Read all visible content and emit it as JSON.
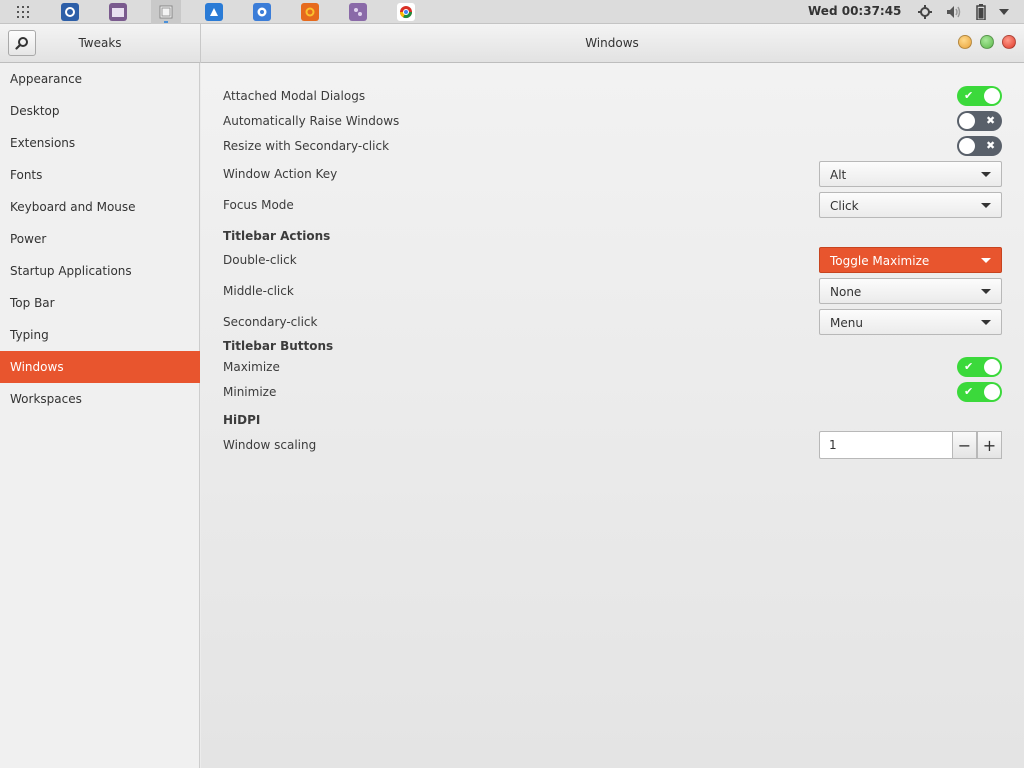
{
  "taskbar": {
    "launchers": [
      {
        "icon": "app-grid-icon"
      },
      {
        "icon": "software-center-icon",
        "color": "#2d5fa8"
      },
      {
        "icon": "files-icon",
        "color": "#7a5a8e"
      },
      {
        "icon": "tweaks-icon",
        "color": "#8e8e8e"
      },
      {
        "icon": "store-icon",
        "color": "#2a7bd6"
      },
      {
        "icon": "settings-icon",
        "color": "#3b7dd8"
      },
      {
        "icon": "firefox-icon",
        "color": "#e66a1d"
      },
      {
        "icon": "editor-icon",
        "color": "#8a6aa8"
      },
      {
        "icon": "chrome-icon",
        "color": "#d93025"
      }
    ],
    "clock": "Wed 00:37:45",
    "tray": [
      "location-icon",
      "volume-icon",
      "battery-icon",
      "menu-arrow-icon"
    ]
  },
  "header": {
    "app_title": "Tweaks",
    "page_title": "Windows"
  },
  "sidebar": {
    "items": [
      {
        "label": "Appearance"
      },
      {
        "label": "Desktop"
      },
      {
        "label": "Extensions"
      },
      {
        "label": "Fonts"
      },
      {
        "label": "Keyboard and Mouse"
      },
      {
        "label": "Power"
      },
      {
        "label": "Startup Applications"
      },
      {
        "label": "Top Bar"
      },
      {
        "label": "Typing"
      },
      {
        "label": "Windows",
        "selected": true
      },
      {
        "label": "Workspaces"
      }
    ]
  },
  "main": {
    "attached_modal": {
      "label": "Attached Modal Dialogs",
      "enabled": true
    },
    "auto_raise": {
      "label": "Automatically Raise Windows",
      "enabled": false
    },
    "resize_secondary": {
      "label": "Resize with Secondary-click",
      "enabled": false
    },
    "action_key": {
      "label": "Window Action Key",
      "value": "Alt"
    },
    "focus_mode": {
      "label": "Focus Mode",
      "value": "Click"
    },
    "titlebar_actions": {
      "heading": "Titlebar Actions",
      "double_click": {
        "label": "Double-click",
        "value": "Toggle Maximize"
      },
      "middle_click": {
        "label": "Middle-click",
        "value": "None"
      },
      "secondary_click": {
        "label": "Secondary-click",
        "value": "Menu"
      }
    },
    "titlebar_buttons": {
      "heading": "Titlebar Buttons",
      "maximize": {
        "label": "Maximize",
        "enabled": true
      },
      "minimize": {
        "label": "Minimize",
        "enabled": true
      }
    },
    "hidpi": {
      "heading": "HiDPI",
      "scaling": {
        "label": "Window scaling",
        "value": "1",
        "minus": "−",
        "plus": "+"
      }
    }
  },
  "switch_glyphs": {
    "on": "✔",
    "off": "✖"
  },
  "colors": {
    "accent": "#e8552e",
    "switch_on": "#3bd93b",
    "switch_off": "#59606a"
  }
}
